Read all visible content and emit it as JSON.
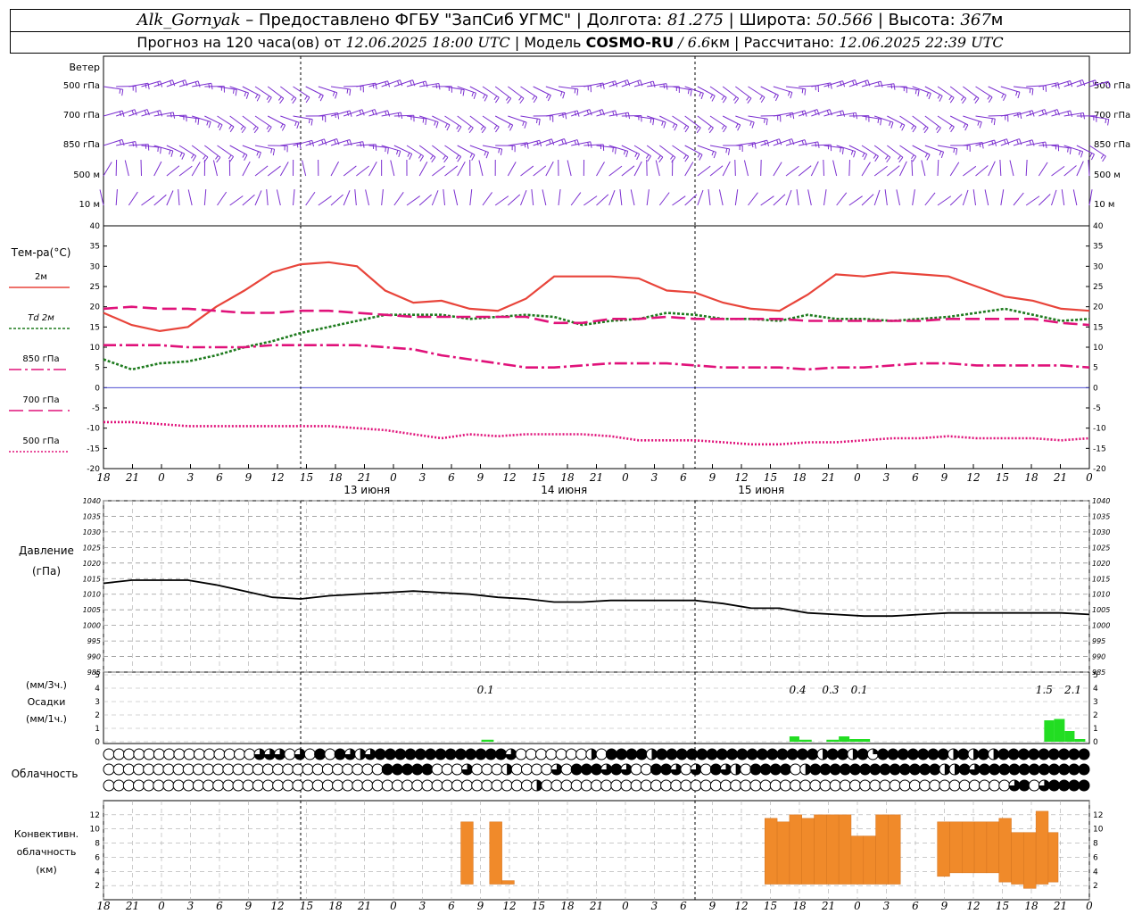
{
  "header": {
    "station": "Alk_Gornyak",
    "provider": " – Предоставлено ФГБУ \"ЗапСиб УГМС\" | Долгота: ",
    "lon": "81.275",
    "lat_label": " | Широта: ",
    "lat": "50.566",
    "alt_label": " | Высота: ",
    "alt": "367",
    "alt_unit": "м",
    "forecast_label": "Прогноз на 120 часа(ов) от ",
    "forecast_start": "12.06.2025 18:00 UTC",
    "model_label": " | Модель ",
    "model": "COSMO-RU",
    "resolution": " / 6.6",
    "res_unit": "км",
    "computed_label": " | Рассчитано: ",
    "computed": "12.06.2025 22:39 UTC"
  },
  "chart_data": [
    {
      "type": "line",
      "panel": "wind",
      "title": "Ветер",
      "levels": [
        "500 гПа",
        "700 гПа",
        "850 гПа",
        "500 м",
        "10 м"
      ],
      "color": "#7b2fd0"
    },
    {
      "type": "line",
      "panel": "temperature",
      "ylabel": "Тем-ра(°С)",
      "ylim": [
        -20,
        40
      ],
      "yticks": [
        -20,
        -15,
        -10,
        -5,
        0,
        5,
        10,
        15,
        20,
        25,
        30,
        35,
        40
      ],
      "x": [
        18,
        21,
        24,
        27,
        30,
        33,
        36,
        39,
        42,
        45,
        48,
        51,
        54,
        57,
        60,
        63,
        66,
        69,
        72,
        75,
        78,
        81,
        84,
        87,
        90,
        93,
        96,
        99,
        102,
        105,
        108,
        111,
        114,
        117,
        120,
        123,
        126,
        129,
        132,
        135,
        138
      ],
      "series": [
        {
          "name": "2м",
          "color": "#e8443a",
          "style": "solid",
          "values": [
            18.5,
            15.5,
            14,
            15,
            20,
            24,
            28.5,
            30.5,
            31,
            30,
            24,
            21,
            21.5,
            19.5,
            19,
            22,
            27.5,
            27.5,
            27.5,
            27,
            24,
            23.5,
            21,
            19.5,
            19,
            23,
            28,
            27.5,
            28.5,
            28,
            27.5,
            25,
            22.5,
            21.5,
            19.5,
            19
          ]
        },
        {
          "name": "Td 2м",
          "color": "#1e7b1e",
          "style": "dotted",
          "values": [
            7,
            4.5,
            6,
            6.5,
            8,
            10,
            11.5,
            13.5,
            15,
            16.5,
            18,
            18,
            18,
            17,
            17.5,
            18,
            17.5,
            15.5,
            16.5,
            17,
            18.5,
            18,
            17,
            17,
            16.5,
            18,
            17,
            17,
            16.5,
            17,
            17.5,
            18.5,
            19.5,
            18,
            16.5,
            17
          ]
        },
        {
          "name": "850 гПа",
          "color": "#e0127a",
          "style": "dashdot",
          "values": [
            10.5,
            10.5,
            10.5,
            10,
            10,
            10,
            10.5,
            10.5,
            10.5,
            10.5,
            10,
            9.5,
            8,
            7,
            6,
            5,
            5,
            5.5,
            6,
            6,
            6,
            5.5,
            5,
            5,
            5,
            4.5,
            5,
            5,
            5.5,
            6,
            6,
            5.5,
            5.5,
            5.5,
            5.5,
            5
          ]
        },
        {
          "name": "700 гПа",
          "color": "#e0127a",
          "style": "dashed",
          "values": [
            19.5,
            20,
            19.5,
            19.5,
            19,
            18.5,
            18.5,
            19,
            19,
            18.5,
            18,
            17.5,
            17.5,
            17.5,
            17.5,
            17.5,
            16,
            16,
            17,
            17,
            17.5,
            17,
            17,
            17,
            17,
            16.5,
            16.5,
            16.5,
            16.5,
            16.5,
            17,
            17,
            17,
            17,
            16,
            15.5
          ]
        },
        {
          "name": "500 гПа",
          "color": "#e0127a",
          "style": "dotted2",
          "values": [
            -8.5,
            -8.5,
            -9,
            -9.5,
            -9.5,
            -9.5,
            -9.5,
            -9.5,
            -9.5,
            -10,
            -10.5,
            -11.5,
            -12.5,
            -11.5,
            -12,
            -11.5,
            -11.5,
            -11.5,
            -12,
            -13,
            -13,
            -13,
            -13.5,
            -14,
            -14,
            -13.5,
            -13.5,
            -13,
            -12.5,
            -12.5,
            -12,
            -12.5,
            -12.5,
            -12.5,
            -13,
            -12.5
          ]
        }
      ],
      "xticklabels": [
        "18",
        "21",
        "0",
        "3",
        "6",
        "9",
        "12",
        "15",
        "18",
        "21",
        "0",
        "3",
        "6",
        "9",
        "12",
        "15",
        "18",
        "21",
        "0",
        "3",
        "6",
        "9",
        "12",
        "15",
        "18",
        "21",
        "0",
        "3",
        "6",
        "9",
        "12",
        "15",
        "18",
        "21",
        "0"
      ],
      "days": [
        "13 июня",
        "14 июня",
        "15 июня"
      ]
    },
    {
      "type": "line",
      "panel": "pressure",
      "ylabel": "Давление",
      "yunit": "(гПа)",
      "ylim": [
        985,
        1040
      ],
      "yticks": [
        985,
        990,
        995,
        1000,
        1005,
        1010,
        1015,
        1020,
        1025,
        1030,
        1035,
        1040
      ],
      "color": "#000000",
      "values": [
        1013.5,
        1014.5,
        1014.5,
        1014.5,
        1013,
        1011,
        1009,
        1008.5,
        1009.5,
        1010,
        1010.5,
        1011,
        1010.5,
        1010,
        1009,
        1008.5,
        1007.5,
        1007.5,
        1008,
        1008,
        1008,
        1008,
        1007,
        1005.5,
        1005.5,
        1004,
        1003.5,
        1003,
        1003,
        1003.5,
        1004,
        1004,
        1004,
        1004,
        1004,
        1003.5
      ]
    },
    {
      "type": "bar",
      "panel": "precipitation",
      "ylabel": "(мм/3ч.)",
      "ylabel2": "Осадки",
      "ylabel3": "(мм/1ч.)",
      "ylim": [
        0,
        5
      ],
      "yticks": [
        0,
        1,
        2,
        3,
        4,
        5
      ],
      "color": "#22dd22",
      "labels": [
        {
          "x": 64.5,
          "text": "0.1"
        },
        {
          "x": 102.5,
          "text": "0.4"
        },
        {
          "x": 106.5,
          "text": "0.3"
        },
        {
          "x": 110,
          "text": "0.1"
        },
        {
          "x": 132.5,
          "text": "1.5"
        },
        {
          "x": 136,
          "text": "2.1"
        }
      ],
      "bars": [
        {
          "x": 64,
          "w": 1.5,
          "v": 0.15
        },
        {
          "x": 101.5,
          "w": 1.2,
          "v": 0.4
        },
        {
          "x": 102.7,
          "w": 1.5,
          "v": 0.15
        },
        {
          "x": 106,
          "w": 1.5,
          "v": 0.15
        },
        {
          "x": 107.5,
          "w": 1.3,
          "v": 0.4
        },
        {
          "x": 108.8,
          "w": 2.5,
          "v": 0.2
        },
        {
          "x": 132.5,
          "w": 1.2,
          "v": 1.6
        },
        {
          "x": 133.7,
          "w": 1.3,
          "v": 1.7
        },
        {
          "x": 135,
          "w": 1.2,
          "v": 0.8
        },
        {
          "x": 136.2,
          "w": 1.3,
          "v": 0.2
        }
      ]
    },
    {
      "type": "table",
      "panel": "cloudiness",
      "ylabel": "Облачность",
      "rows": [
        [
          0,
          0,
          0,
          0,
          0,
          0,
          0,
          0,
          0,
          0,
          0,
          0,
          0,
          0,
          0,
          3,
          3,
          3,
          0,
          3,
          0,
          4,
          0,
          4,
          3,
          2,
          3,
          4,
          4,
          4,
          4,
          4,
          4,
          4,
          4,
          4,
          4,
          4,
          4,
          4,
          3,
          0,
          0,
          0,
          0,
          0,
          0,
          0,
          2,
          0,
          4,
          4,
          4,
          4,
          2,
          4,
          4,
          4,
          4,
          4,
          4,
          4,
          4,
          4,
          4,
          4,
          4,
          4,
          4,
          4,
          4,
          2,
          4,
          4,
          2,
          4,
          1,
          4,
          4,
          4,
          4,
          4,
          4,
          4,
          2,
          4,
          2,
          4,
          2,
          4,
          4,
          4,
          4,
          4,
          4,
          4,
          4,
          4
        ],
        [
          0,
          0,
          0,
          0,
          0,
          0,
          0,
          0,
          0,
          0,
          0,
          0,
          0,
          0,
          0,
          0,
          0,
          0,
          0,
          0,
          0,
          0,
          0,
          0,
          0,
          0,
          0,
          0,
          4,
          4,
          4,
          4,
          4,
          0,
          0,
          0,
          3,
          0,
          0,
          0,
          2,
          0,
          0,
          0,
          0,
          3,
          0,
          4,
          4,
          4,
          3,
          4,
          3,
          0,
          0,
          4,
          4,
          3,
          0,
          3,
          0,
          4,
          3,
          2,
          0,
          4,
          4,
          4,
          4,
          0,
          2,
          4,
          4,
          4,
          4,
          4,
          4,
          4,
          4,
          4,
          4,
          4,
          4,
          4,
          2,
          2,
          4,
          3,
          4,
          4,
          4,
          4,
          4,
          4,
          4,
          4,
          4,
          4,
          4
        ],
        [
          0,
          0,
          0,
          0,
          0,
          0,
          0,
          0,
          0,
          0,
          0,
          0,
          0,
          0,
          0,
          0,
          0,
          0,
          0,
          0,
          0,
          0,
          0,
          0,
          0,
          0,
          0,
          0,
          0,
          0,
          0,
          0,
          0,
          0,
          0,
          0,
          0,
          0,
          0,
          0,
          0,
          0,
          0,
          2,
          0,
          0,
          0,
          0,
          0,
          0,
          0,
          0,
          0,
          0,
          0,
          0,
          0,
          0,
          0,
          0,
          0,
          0,
          0,
          0,
          0,
          0,
          0,
          0,
          0,
          0,
          0,
          0,
          0,
          0,
          0,
          0,
          0,
          0,
          0,
          0,
          0,
          0,
          0,
          0,
          0,
          0,
          0,
          0,
          0,
          0,
          0,
          3,
          4,
          0,
          3,
          4,
          4,
          4,
          4
        ]
      ]
    },
    {
      "type": "bar",
      "panel": "convective",
      "ylabel": "Конвективн.",
      "ylabel2": "облачность",
      "ylabel3": "(км)",
      "ylim": [
        0,
        14
      ],
      "yticks": [
        2,
        4,
        6,
        8,
        10,
        12
      ],
      "color": "#f08a2a",
      "bars": [
        {
          "x": 61.5,
          "w": 1.5,
          "lo": 2.2,
          "hi": 11
        },
        {
          "x": 65,
          "w": 1.5,
          "lo": 2.2,
          "hi": 11
        },
        {
          "x": 66.5,
          "w": 1.5,
          "lo": 2.2,
          "hi": 2.7
        },
        {
          "x": 98.5,
          "w": 1.5,
          "lo": 2.2,
          "hi": 11.5
        },
        {
          "x": 100,
          "w": 1.5,
          "lo": 2.2,
          "hi": 11
        },
        {
          "x": 101.5,
          "w": 1.5,
          "lo": 2.2,
          "hi": 12
        },
        {
          "x": 103,
          "w": 1.5,
          "lo": 2.2,
          "hi": 11.5
        },
        {
          "x": 104.5,
          "w": 1.5,
          "lo": 2.2,
          "hi": 12
        },
        {
          "x": 106,
          "w": 1.5,
          "lo": 2.2,
          "hi": 12
        },
        {
          "x": 107.5,
          "w": 1.5,
          "lo": 2.2,
          "hi": 12
        },
        {
          "x": 109,
          "w": 1.5,
          "lo": 2.2,
          "hi": 9
        },
        {
          "x": 110.5,
          "w": 1.5,
          "lo": 2.2,
          "hi": 9
        },
        {
          "x": 112,
          "w": 1.5,
          "lo": 2.2,
          "hi": 12
        },
        {
          "x": 113.5,
          "w": 1.5,
          "lo": 2.2,
          "hi": 12
        },
        {
          "x": 119.5,
          "w": 1.5,
          "lo": 3.3,
          "hi": 11
        },
        {
          "x": 121,
          "w": 1.5,
          "lo": 3.8,
          "hi": 11
        },
        {
          "x": 122.5,
          "w": 1.5,
          "lo": 3.8,
          "hi": 11
        },
        {
          "x": 124,
          "w": 1.5,
          "lo": 3.8,
          "hi": 11
        },
        {
          "x": 125.5,
          "w": 1.5,
          "lo": 3.8,
          "hi": 11
        },
        {
          "x": 127,
          "w": 1.5,
          "lo": 2.5,
          "hi": 11.5
        },
        {
          "x": 128.5,
          "w": 1.5,
          "lo": 2.2,
          "hi": 9.5
        },
        {
          "x": 130,
          "w": 1.5,
          "lo": 1.6,
          "hi": 9.5
        },
        {
          "x": 131.5,
          "w": 1.5,
          "lo": 2.2,
          "hi": 12.5
        },
        {
          "x": 133,
          "w": 1.2,
          "lo": 2.5,
          "hi": 9.5
        }
      ],
      "xticklabels": [
        "18",
        "21",
        "0",
        "3",
        "6",
        "9",
        "12",
        "15",
        "18",
        "21",
        "0",
        "3",
        "6",
        "9",
        "12",
        "15",
        "18",
        "21",
        "0",
        "3",
        "6",
        "9",
        "12",
        "15",
        "18",
        "21",
        "0",
        "3",
        "6",
        "9",
        "12",
        "15",
        "18",
        "21",
        "0"
      ]
    }
  ]
}
